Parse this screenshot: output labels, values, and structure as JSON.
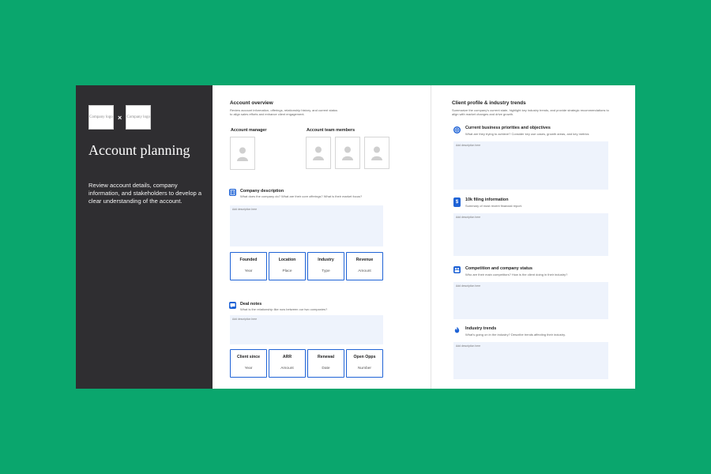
{
  "intro": {
    "logo_left": "Company logo",
    "logo_right": "Company logo",
    "cross": "×",
    "title": "Account planning",
    "description": "Review account details, company information, and stakeholders to develop a clear understanding of the account."
  },
  "overview": {
    "title": "Account overview",
    "subtitle": "Review account information, offerings, relationship history, and current status to align sales efforts and enhance client engagement.",
    "manager_label": "Account manager",
    "team_label": "Account team members"
  },
  "company": {
    "title": "Company description",
    "question": "What does the company do? What are their core offerings? What is their market focus?",
    "placeholder": "Add description here",
    "stats": [
      {
        "label": "Founded",
        "value": "Year"
      },
      {
        "label": "Location",
        "value": "Place"
      },
      {
        "label": "Industry",
        "value": "Type"
      },
      {
        "label": "Revenue",
        "value": "Amount"
      }
    ]
  },
  "deal": {
    "title": "Deal notes",
    "question": "What is the relationship like now between our two companies?",
    "placeholder": "Add description here",
    "stats": [
      {
        "label": "Client since",
        "value": "Year"
      },
      {
        "label": "ARR",
        "value": "Amount"
      },
      {
        "label": "Renewal",
        "value": "Date"
      },
      {
        "label": "Open Opps",
        "value": "Number"
      }
    ]
  },
  "profile": {
    "title": "Client profile & industry trends",
    "subtitle": "Summarize the company's current state, highlight key industry trends, and provide strategic recommendations to align with market changes and drive growth.",
    "sections": [
      {
        "title": "Current business priorities and objectives",
        "question": "What are they trying to achieve? Consider key use cases, growth areas, and key metrics",
        "placeholder": "Add description here",
        "icon": "target-icon"
      },
      {
        "title": "10k filing information",
        "question": "Summary of most recent financial report.",
        "placeholder": "Add description here",
        "icon": "dollar-icon"
      },
      {
        "title": "Competition and company status",
        "question": "Who are their main competitors? How is the client doing in their industry?",
        "placeholder": "Add description here",
        "icon": "team-icon"
      },
      {
        "title": "Industry trends",
        "question": "What's going on in the industry? Describe trends affecting their industry.",
        "placeholder": "Add description here",
        "icon": "flame-icon"
      }
    ]
  },
  "colors": {
    "background": "#0aa66d",
    "panel": "#2f2e31",
    "accent": "#1f63d6",
    "note": "#eef3fc"
  }
}
